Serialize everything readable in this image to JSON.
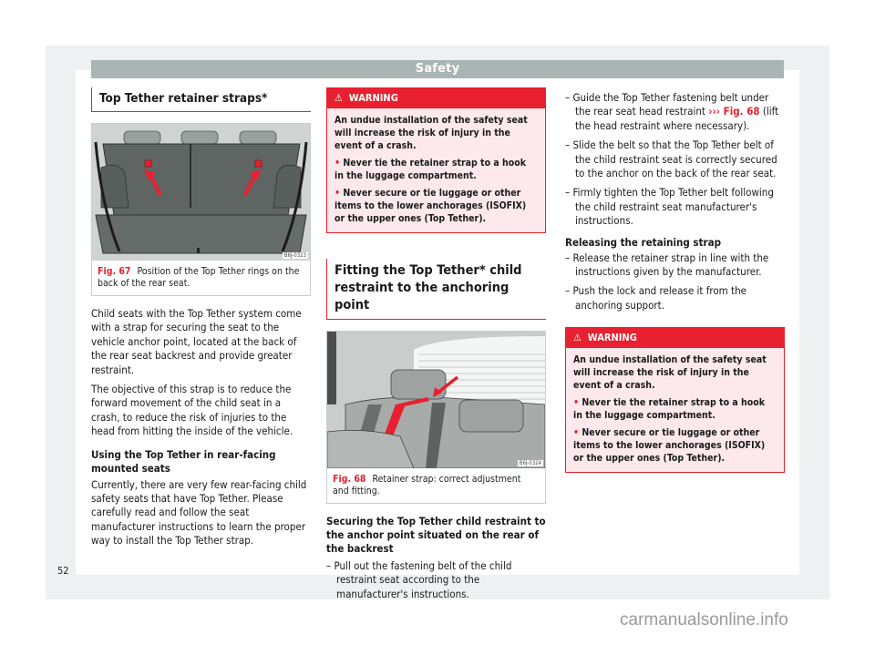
{
  "header": {
    "title": "Safety"
  },
  "col1": {
    "title": "Top Tether retainer straps*",
    "figure": {
      "number": "Fig. 67",
      "caption": "Position of the Top Tether rings on the back of the rear seat.",
      "code": "B6J-0323",
      "image_desc": "luggage-compartment-rear-seat-illustration"
    },
    "para1": "Child seats with the Top Tether system come with a strap for securing the seat to the vehicle anchor point, located at the back of the rear seat backrest and provide greater restraint.",
    "para2": "The objective of this strap is to reduce the forward movement of the child seat in a crash, to reduce the risk of injuries to the head from hitting the inside of the vehicle.",
    "subheading": "Using the Top Tether in rear-facing mounted seats",
    "para3": "Currently, there are very few rear-facing child safety seats that have Top Tether. Please carefully read and follow the seat manufacturer instructions to learn the proper way to install the Top Tether strap."
  },
  "col2": {
    "warning": {
      "label": "WARNING",
      "intro": "An undue installation of the safety seat will increase the risk of injury in the event of a crash.",
      "items": [
        "Never tie the retainer strap to a hook in the luggage compartment.",
        "Never secure or tie luggage or other items to the lower anchorages (ISOFIX) or the upper ones (Top Tether)."
      ]
    },
    "title": "Fitting the Top Tether* child restraint to the anchoring point",
    "figure": {
      "number": "Fig. 68",
      "caption": "Retainer strap: correct adjustment and fitting.",
      "code": "B6J-0324",
      "image_desc": "rear-seat-head-restraint-strap-illustration"
    },
    "subheading": "Securing the Top Tether child restraint to the anchor point situated on the rear of the backrest",
    "steps": [
      "Pull out the fastening belt of the child restraint seat according to the manufacturer's instructions."
    ]
  },
  "col3": {
    "steps": [
      {
        "before": "Guide the Top Tether fastening belt under the rear seat head restraint ",
        "ref_arrow": "›››",
        "ref": "Fig. 68",
        "after": " (lift the head restraint where necessary)."
      },
      {
        "before": "Slide the belt so that the Top Tether belt of the child restraint seat is correctly secured to the anchor on the back of the rear seat."
      },
      {
        "before": "Firmly tighten the Top Tether belt following the child restraint seat manufacturer's instructions."
      }
    ],
    "subheading": "Releasing the retaining strap",
    "release_steps": [
      "Release the retainer strap in line with the instructions given by the manufacturer.",
      "Push the lock and release it from the anchoring support."
    ],
    "warning": {
      "label": "WARNING",
      "intro": "An undue installation of the safety seat will increase the risk of injury in the event of a crash.",
      "items": [
        "Never tie the retainer strap to a hook in the luggage compartment.",
        "Never secure or tie luggage or other items to the lower anchorages (ISOFIX) or the upper ones (Top Tether)."
      ]
    }
  },
  "footer": {
    "page_number": "52",
    "watermark": "carmanualsonline.info"
  },
  "colors": {
    "accent": "#e8202f",
    "header_bar": "#a9b5b3",
    "warning_bg": "#fde9ec"
  },
  "icons": {
    "warning": "warning-triangle-icon",
    "bullet": "bullet-icon",
    "dash": "dash"
  }
}
